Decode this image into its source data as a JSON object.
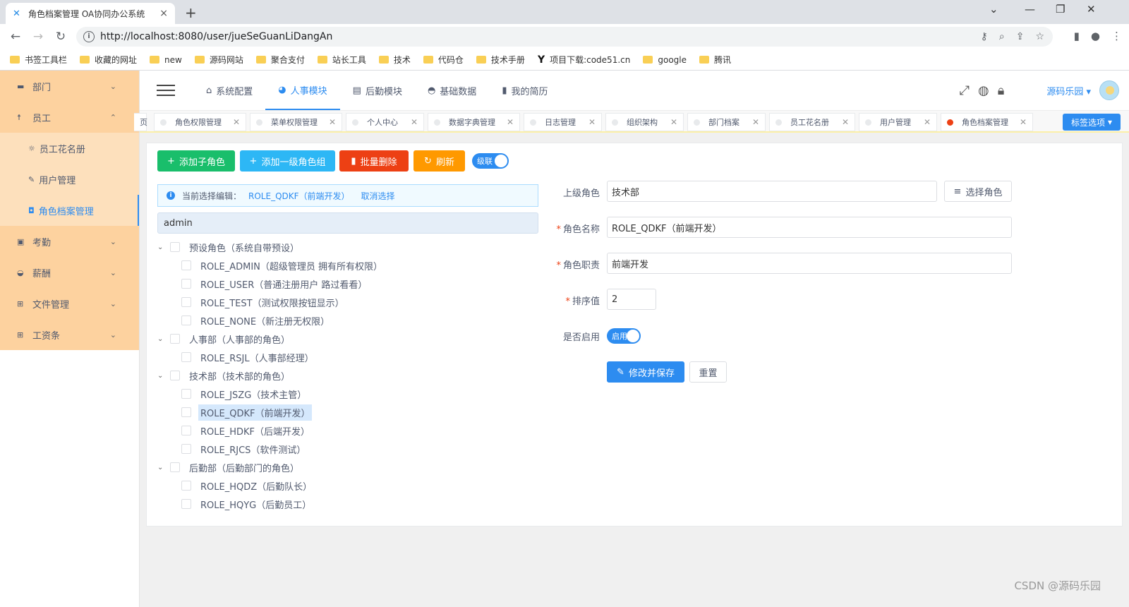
{
  "browser": {
    "tab_title": "角色档案管理 OA协同办公系统",
    "url": "http://localhost:8080/user/jueSeGuanLiDangAn",
    "bookmarks": [
      "书签工具栏",
      "收藏的网址",
      "new",
      "源码网站",
      "聚合支付",
      "站长工具",
      "技术",
      "代码仓",
      "技术手册",
      "项目下载:code51.cn",
      "google",
      "腾讯"
    ]
  },
  "sidebar": {
    "items": [
      {
        "label": "部门"
      },
      {
        "label": "员工"
      },
      {
        "label": "考勤"
      },
      {
        "label": "薪酬"
      },
      {
        "label": "文件管理"
      },
      {
        "label": "工资条"
      }
    ],
    "sub_items": [
      {
        "label": "员工花名册"
      },
      {
        "label": "用户管理"
      },
      {
        "label": "角色档案管理"
      }
    ]
  },
  "topnav": {
    "items": [
      "系统配置",
      "人事模块",
      "后勤模块",
      "基础数据",
      "我的简历"
    ],
    "user": "源码乐园"
  },
  "tags": {
    "first_partial": "页",
    "items": [
      "角色权限管理",
      "菜单权限管理",
      "个人中心",
      "数据字典管理",
      "日志管理",
      "组织架构",
      "部门档案",
      "员工花名册",
      "用户管理",
      "角色档案管理"
    ],
    "options_label": "标签选项"
  },
  "toolbar": {
    "add_child": "添加子角色",
    "add_top": "添加一级角色组",
    "batch_delete": "批量删除",
    "refresh": "刷新",
    "cascade": "级联"
  },
  "alert": {
    "prefix": "当前选择编辑：",
    "selected": "ROLE_QDKF（前端开发）",
    "cancel": "取消选择"
  },
  "search": {
    "value": "admin"
  },
  "tree": [
    {
      "label": "预设角色（系统自带预设）",
      "level": 0
    },
    {
      "label": "ROLE_ADMIN（超级管理员 拥有所有权限）",
      "level": 1
    },
    {
      "label": "ROLE_USER（普通注册用户 路过看看）",
      "level": 1
    },
    {
      "label": "ROLE_TEST（测试权限按钮显示）",
      "level": 1
    },
    {
      "label": "ROLE_NONE（新注册无权限）",
      "level": 1
    },
    {
      "label": "人事部（人事部的角色）",
      "level": 0
    },
    {
      "label": "ROLE_RSJL（人事部经理）",
      "level": 1
    },
    {
      "label": "技术部（技术部的角色）",
      "level": 0
    },
    {
      "label": "ROLE_JSZG（技术主管）",
      "level": 1
    },
    {
      "label": "ROLE_QDKF（前端开发）",
      "level": 1,
      "selected": true
    },
    {
      "label": "ROLE_HDKF（后端开发）",
      "level": 1
    },
    {
      "label": "ROLE_RJCS（软件测试）",
      "level": 1
    },
    {
      "label": "后勤部（后勤部门的角色）",
      "level": 0
    },
    {
      "label": "ROLE_HQDZ（后勤队长）",
      "level": 1
    },
    {
      "label": "ROLE_HQYG（后勤员工）",
      "level": 1
    }
  ],
  "form": {
    "parent_label": "上级角色",
    "parent_value": "技术部",
    "choose_role": "选择角色",
    "name_label": "角色名称",
    "name_value": "ROLE_QDKF（前端开发）",
    "duty_label": "角色职责",
    "duty_value": "前端开发",
    "sort_label": "排序值",
    "sort_value": "2",
    "enable_label": "是否启用",
    "enable_switch": "启用",
    "save": "修改并保存",
    "reset": "重置"
  },
  "watermark": "CSDN @源码乐园"
}
